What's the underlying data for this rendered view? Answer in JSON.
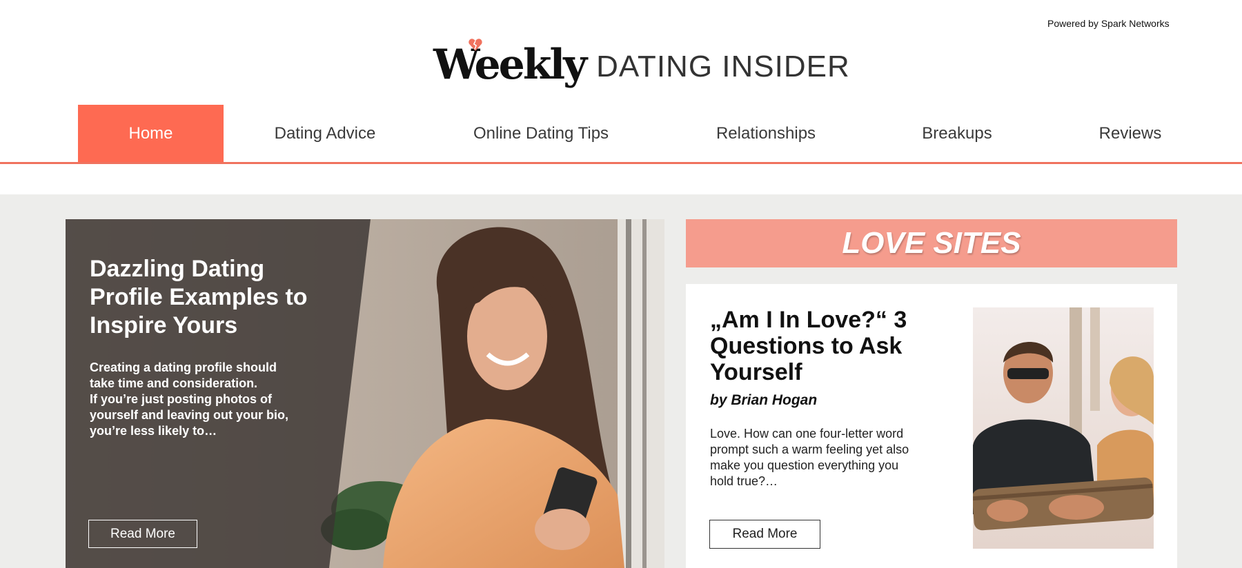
{
  "header": {
    "powered_by": "Powered by Spark Networks",
    "logo_weekly": "Weekly",
    "logo_dating": "DATING INSIDER"
  },
  "nav": {
    "items": [
      {
        "label": "Home",
        "active": true
      },
      {
        "label": "Dating Advice"
      },
      {
        "label": "Online Dating Tips"
      },
      {
        "label": "Relationships"
      },
      {
        "label": "Breakups"
      },
      {
        "label": "Reviews"
      }
    ]
  },
  "hero": {
    "title": "Dazzling Dating Profile Examples to Inspire Yours",
    "excerpt_line1": "Creating a dating profile should take time and consideration.",
    "excerpt_line2": "If you’re just posting photos of yourself and leaving out your bio, you’re less likely to…",
    "button": "Read More",
    "image": "woman-smiling-at-phone-photo"
  },
  "love_sites": {
    "title": "LOVE SITES",
    "card": {
      "title": "„Am I In Love?“ 3 Questions to Ask Yourself",
      "author": "by Brian Hogan",
      "excerpt": "Love. How can one four-letter word prompt such a warm feeling yet also make you question everything you hold true?…",
      "button": "Read More",
      "image": "couple-with-surfboard-photo"
    }
  },
  "colors": {
    "accent": "#fe6a52",
    "banner": "#f59c8d",
    "background": "#ededeb"
  }
}
